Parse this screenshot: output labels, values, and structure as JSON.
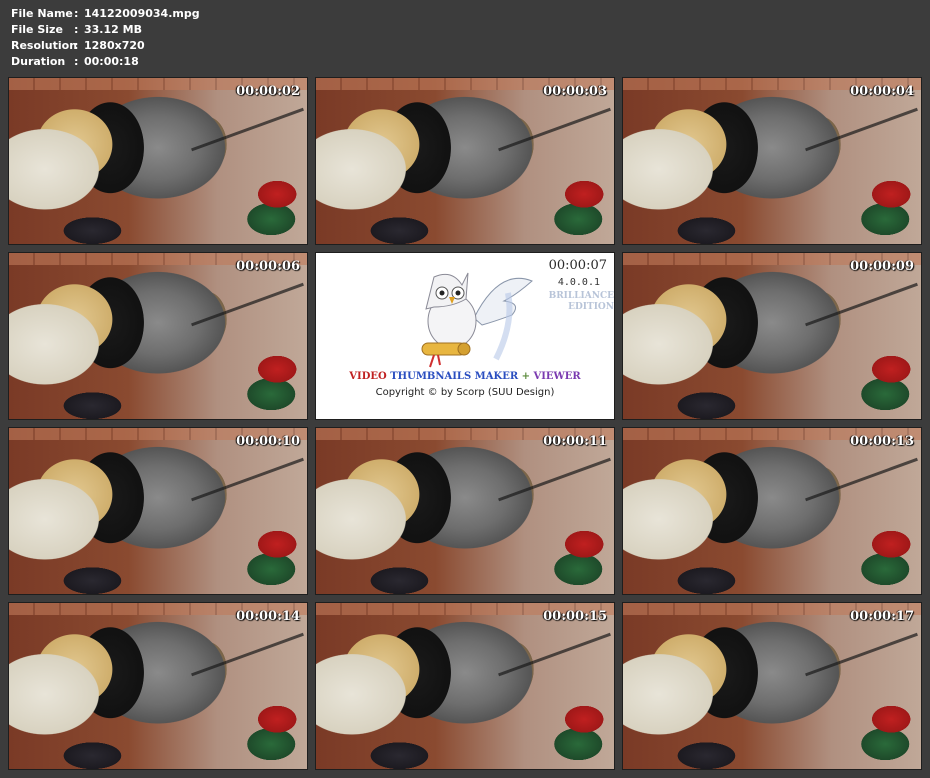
{
  "file_info": {
    "rows": [
      {
        "key": "File Name",
        "sep": ":",
        "value": "14122009034.mpg"
      },
      {
        "key": "File Size",
        "sep": ":",
        "value": "33.12 MB"
      },
      {
        "key": "Resolution",
        "sep": ":",
        "value": "1280x720"
      },
      {
        "key": "Duration",
        "sep": ":",
        "value": "00:00:18"
      }
    ]
  },
  "thumbnails": [
    {
      "timestamp": "00:00:02"
    },
    {
      "timestamp": "00:00:03"
    },
    {
      "timestamp": "00:00:04"
    },
    {
      "timestamp": "00:00:06"
    },
    {
      "timestamp": "00:00:07"
    },
    {
      "timestamp": "00:00:09"
    },
    {
      "timestamp": "00:00:10"
    },
    {
      "timestamp": "00:00:11"
    },
    {
      "timestamp": "00:00:13"
    },
    {
      "timestamp": "00:00:14"
    },
    {
      "timestamp": "00:00:15"
    },
    {
      "timestamp": "00:00:17"
    }
  ],
  "logo": {
    "version": "4.0.0.1",
    "edition_line1": "BRILLIANCE",
    "edition_line2": "EDITION",
    "title_word1": "VIDEO",
    "title_word2": "THUMBNAILS",
    "title_word3": "MAKER",
    "title_plus": "+",
    "title_word4": "VIEWER",
    "copyright": "Copyright © by Scorp (SUU Design)"
  },
  "colors": {
    "background": "#3c3c3c",
    "logo_red": "#c02020",
    "logo_blue": "#2a4ec0",
    "logo_purple": "#7a3ab0"
  }
}
